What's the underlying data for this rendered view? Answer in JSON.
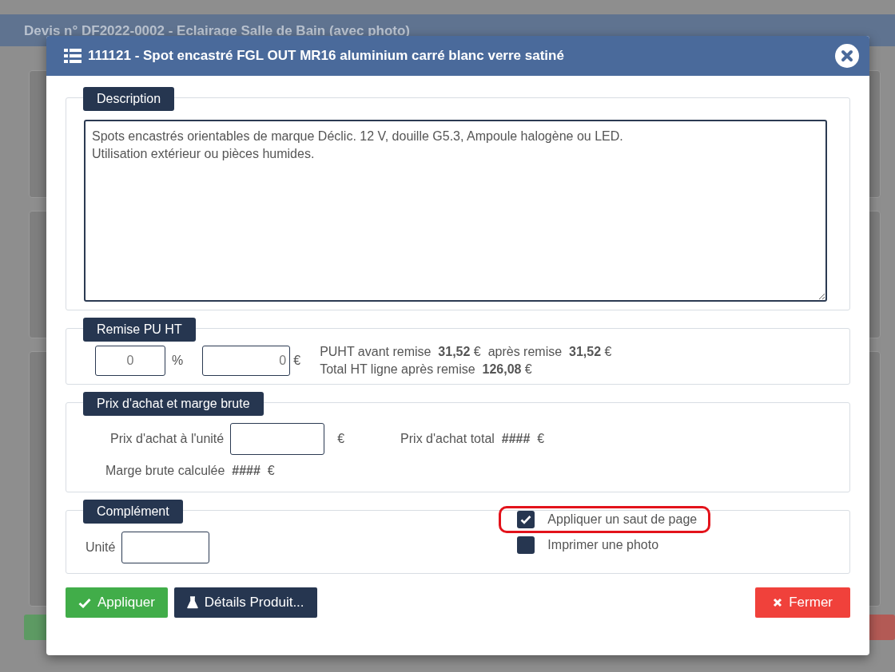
{
  "background_window": {
    "title": "Devis n° DF2022-0002 - Eclairage Salle de Bain (avec photo)"
  },
  "modal": {
    "title": "111121 - Spot encastré FGL OUT MR16 aluminium carré blanc verre satiné"
  },
  "description": {
    "legend": "Description",
    "value": "Spots encastrés orientables de marque Déclic. 12 V, douille G5.3, Ampoule halogène ou LED.\nUtilisation extérieur ou pièces humides."
  },
  "discount": {
    "legend": "Remise PU HT",
    "percent_value": "0",
    "percent_unit": "%",
    "amount_value": "0",
    "amount_unit": "€",
    "lines": [
      "PUHT avant remise  **31,52** €  après remise  **31,52** €",
      "Total HT ligne après remise  **126,08** €"
    ]
  },
  "purchase": {
    "legend": "Prix d'achat et marge brute",
    "unit_price_label": "Prix d'achat à l'unité",
    "unit_price_currency": "€",
    "total": "Prix d'achat total  **####**  €",
    "margin": "Marge brute calculée  **####**  €"
  },
  "complement": {
    "legend": "Complément",
    "unit_label": "Unité",
    "options": [
      {
        "label": "Appliquer un saut de page",
        "checked": true,
        "highlighted": true
      },
      {
        "label": "Imprimer une photo",
        "checked": false,
        "highlighted": false
      }
    ]
  },
  "buttons": [
    {
      "label": "Appliquer",
      "kind": "success"
    },
    {
      "label": "Détails Produit...",
      "kind": "dark"
    },
    {
      "label": "Fermer",
      "kind": "danger"
    }
  ]
}
